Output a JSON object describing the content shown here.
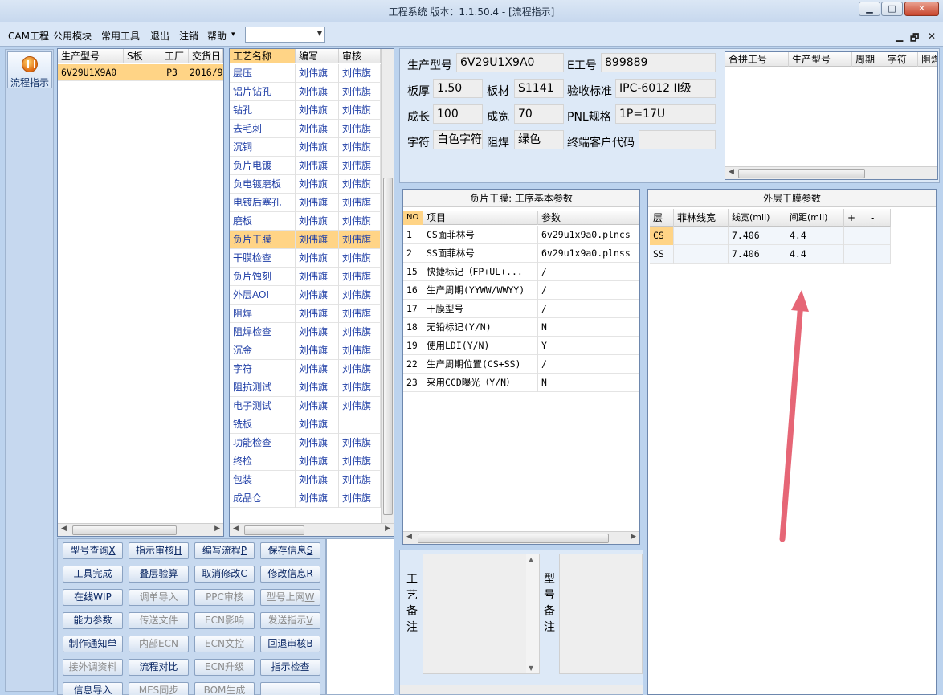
{
  "window": {
    "title": "工程系统   版本：1.1.50.4 - [流程指示]",
    "minimize": "▁",
    "maximize": "□",
    "close": "✕"
  },
  "menu": {
    "items": [
      "CAM工程",
      "公用模块",
      "常用工具",
      "退出",
      "注销",
      "帮助"
    ],
    "help_arrow": "▾",
    "combo_value": "",
    "mdi_min": "▁",
    "mdi_restore": "🗗",
    "mdi_close": "✕"
  },
  "nav": {
    "flow_label": "流程指示"
  },
  "jobs": {
    "headers": [
      "生产型号",
      "S板",
      "工厂",
      "交货日"
    ],
    "rows": [
      {
        "model": "6V29U1X9A0",
        "s": "",
        "factory": "P3",
        "date": "2016/9"
      }
    ]
  },
  "process": {
    "headers": [
      "工艺名称",
      "编写",
      "审核"
    ],
    "rows": [
      {
        "name": "层压",
        "writer": "刘伟旗",
        "reviewer": "刘伟旗"
      },
      {
        "name": "铝片钻孔",
        "writer": "刘伟旗",
        "reviewer": "刘伟旗"
      },
      {
        "name": "钻孔",
        "writer": "刘伟旗",
        "reviewer": "刘伟旗"
      },
      {
        "name": "去毛刺",
        "writer": "刘伟旗",
        "reviewer": "刘伟旗"
      },
      {
        "name": "沉铜",
        "writer": "刘伟旗",
        "reviewer": "刘伟旗"
      },
      {
        "name": "负片电镀",
        "writer": "刘伟旗",
        "reviewer": "刘伟旗"
      },
      {
        "name": "负电镀磨板",
        "writer": "刘伟旗",
        "reviewer": "刘伟旗"
      },
      {
        "name": "电镀后塞孔",
        "writer": "刘伟旗",
        "reviewer": "刘伟旗"
      },
      {
        "name": "磨板",
        "writer": "刘伟旗",
        "reviewer": "刘伟旗"
      },
      {
        "name": "负片干膜",
        "writer": "刘伟旗",
        "reviewer": "刘伟旗"
      },
      {
        "name": "干膜检查",
        "writer": "刘伟旗",
        "reviewer": "刘伟旗"
      },
      {
        "name": "负片蚀刻",
        "writer": "刘伟旗",
        "reviewer": "刘伟旗"
      },
      {
        "name": "外层AOI",
        "writer": "刘伟旗",
        "reviewer": "刘伟旗"
      },
      {
        "name": "阻焊",
        "writer": "刘伟旗",
        "reviewer": "刘伟旗"
      },
      {
        "name": "阻焊检查",
        "writer": "刘伟旗",
        "reviewer": "刘伟旗"
      },
      {
        "name": "沉金",
        "writer": "刘伟旗",
        "reviewer": "刘伟旗"
      },
      {
        "name": "字符",
        "writer": "刘伟旗",
        "reviewer": "刘伟旗"
      },
      {
        "name": "阻抗测试",
        "writer": "刘伟旗",
        "reviewer": "刘伟旗"
      },
      {
        "name": "电子测试",
        "writer": "刘伟旗",
        "reviewer": "刘伟旗"
      },
      {
        "name": "铣板",
        "writer": "刘伟旗",
        "reviewer": ""
      },
      {
        "name": "功能检查",
        "writer": "刘伟旗",
        "reviewer": "刘伟旗"
      },
      {
        "name": "终检",
        "writer": "刘伟旗",
        "reviewer": "刘伟旗"
      },
      {
        "name": "包装",
        "writer": "刘伟旗",
        "reviewer": "刘伟旗"
      },
      {
        "name": "成品仓",
        "writer": "刘伟旗",
        "reviewer": "刘伟旗"
      }
    ]
  },
  "buttons": [
    {
      "label": "型号查询",
      "key": "X",
      "disabled": false
    },
    {
      "label": "指示审核",
      "key": "H",
      "disabled": false
    },
    {
      "label": "编写流程",
      "key": "P",
      "disabled": false
    },
    {
      "label": "保存信息",
      "key": "S",
      "disabled": false
    },
    {
      "label": "工具完成",
      "key": "",
      "disabled": false
    },
    {
      "label": "叠层验算",
      "key": "",
      "disabled": false
    },
    {
      "label": "取消修改",
      "key": "C",
      "disabled": false
    },
    {
      "label": "修改信息",
      "key": "R",
      "disabled": false
    },
    {
      "label": "在线WIP",
      "key": "",
      "disabled": false
    },
    {
      "label": "调单导入",
      "key": "",
      "disabled": true
    },
    {
      "label": "PPC审核",
      "key": "",
      "disabled": true
    },
    {
      "label": "型号上网",
      "key": "W",
      "disabled": true
    },
    {
      "label": "能力参数",
      "key": "",
      "disabled": false
    },
    {
      "label": "传送文件",
      "key": "",
      "disabled": true
    },
    {
      "label": "ECN影响",
      "key": "",
      "disabled": true
    },
    {
      "label": "发送指示",
      "key": "V",
      "disabled": true
    },
    {
      "label": "制作通知单",
      "key": "",
      "disabled": false
    },
    {
      "label": "内部ECN",
      "key": "",
      "disabled": true
    },
    {
      "label": "ECN文控",
      "key": "",
      "disabled": true
    },
    {
      "label": "回退审核",
      "key": "B",
      "disabled": false
    },
    {
      "label": "接外调资料",
      "key": "",
      "disabled": true
    },
    {
      "label": "流程对比",
      "key": "",
      "disabled": false
    },
    {
      "label": "ECN升级",
      "key": "",
      "disabled": true
    },
    {
      "label": "指示检查",
      "key": "",
      "disabled": false
    },
    {
      "label": "信息导入",
      "key": "",
      "disabled": false
    },
    {
      "label": "MES同步",
      "key": "",
      "disabled": true
    },
    {
      "label": "BOM生成",
      "key": "",
      "disabled": true
    },
    {
      "label": "",
      "key": "",
      "disabled": false
    }
  ],
  "info": {
    "model_label": "生产型号",
    "model_value": "6V29U1X9A0",
    "e_label": "E工号",
    "e_value": "899889",
    "thick_label": "板厚",
    "thick_value": "1.50",
    "mat_label": "板材",
    "mat_value": "S1141",
    "std_label": "验收标准",
    "std_value": "IPC-6012 II级",
    "len_label": "成长",
    "len_value": "100",
    "wid_label": "成宽",
    "wid_value": "70",
    "pnl_label": "PNL规格",
    "pnl_value": "1P=17U",
    "char_label": "字符",
    "char_value": "白色字符",
    "mask_label": "阻焊",
    "mask_value": "绿色",
    "cust_label": "终端客户代码",
    "cust_value": ""
  },
  "merge": {
    "headers": [
      "合拼工号",
      "生产型号",
      "周期",
      "字符",
      "阻焊"
    ]
  },
  "params": {
    "title": "负片干膜: 工序基本参数",
    "headers": [
      "NO",
      "项目",
      "参数"
    ],
    "rows": [
      {
        "no": "1",
        "item": "CS面菲林号",
        "value": "6v29u1x9a0.plncs"
      },
      {
        "no": "2",
        "item": "SS面菲林号",
        "value": "6v29u1x9a0.plnss"
      },
      {
        "no": "15",
        "item": "快捷标记（FP+UL+...",
        "value": "/"
      },
      {
        "no": "16",
        "item": "生产周期(YYWW/WWYY)",
        "value": "/"
      },
      {
        "no": "17",
        "item": "干膜型号",
        "value": "/"
      },
      {
        "no": "18",
        "item": "无铅标记(Y/N)",
        "value": "N"
      },
      {
        "no": "19",
        "item": "使用LDI(Y/N)",
        "value": "Y"
      },
      {
        "no": "22",
        "item": "生产周期位置(CS+SS)",
        "value": "/"
      },
      {
        "no": "23",
        "item": "采用CCD曝光（Y/N）",
        "value": "N"
      }
    ]
  },
  "outer": {
    "title": "外层干膜参数",
    "headers": [
      "层",
      "菲林线宽",
      "线宽(mil)",
      "间距(mil)",
      "+",
      "-"
    ],
    "rows": [
      {
        "layer": "CS",
        "film": "",
        "width": "7.406",
        "space": "4.4"
      },
      {
        "layer": "SS",
        "film": "",
        "width": "7.406",
        "space": "4.4"
      }
    ],
    "annotation_color": "#e66676"
  },
  "memos": {
    "process_label": "工艺备注",
    "model_label": "型号备注"
  }
}
